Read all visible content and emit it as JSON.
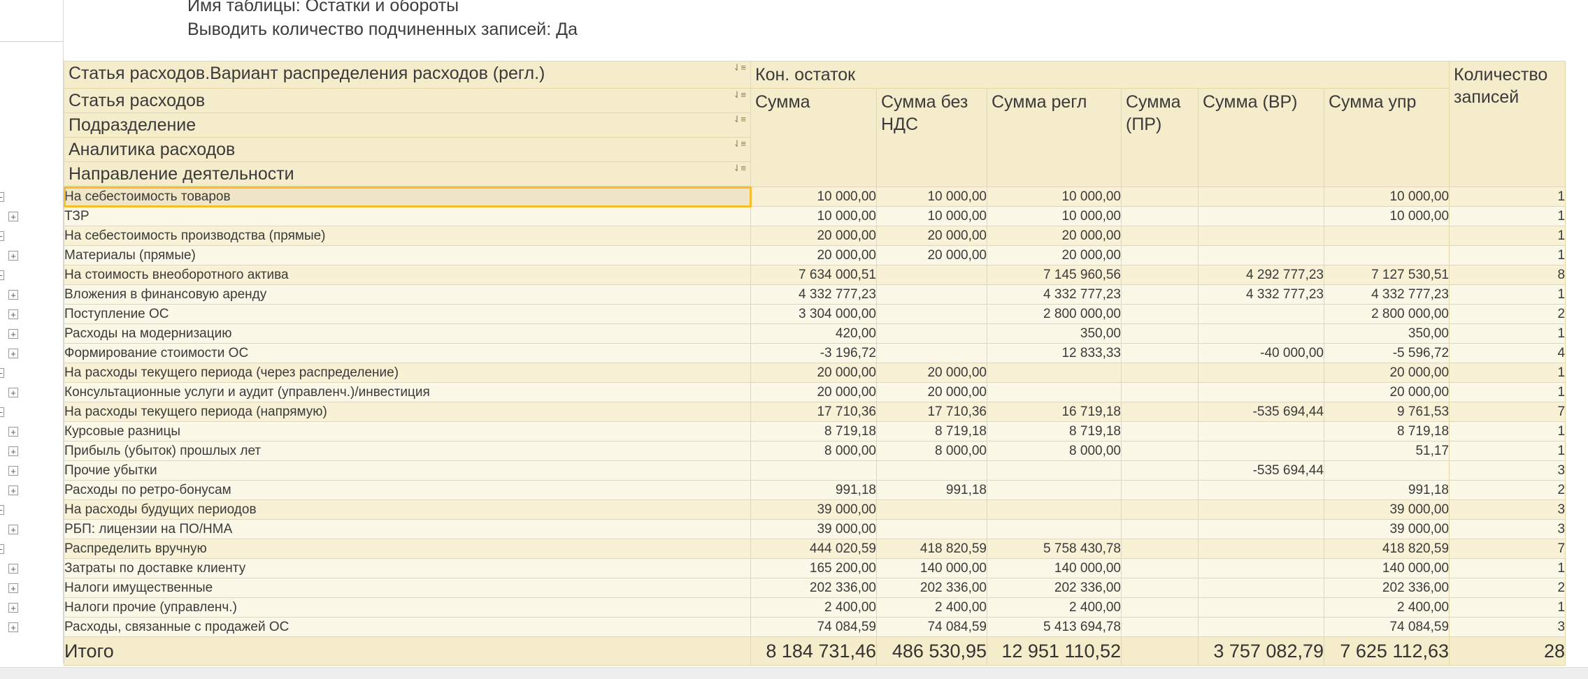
{
  "params": {
    "table_name": "Имя таблицы: Остатки и обороты",
    "show_count": "Выводить количество подчиненных записей: Да"
  },
  "header": {
    "grouping": [
      "Статья расходов.Вариант распределения расходов (регл.)",
      "Статья расходов",
      "Подразделение",
      "Аналитика расходов",
      "Направление деятельности"
    ],
    "sort_icon": "sort-icon",
    "group_title": "Кон. остаток",
    "columns": [
      "Сумма",
      "Сумма без НДС",
      "Сумма регл",
      "Сумма (ПР)",
      "Сумма (ВР)",
      "Сумма упр"
    ],
    "count_col": "Количество записей"
  },
  "rows": [
    {
      "label": "На себестоимость товаров",
      "level": 0,
      "selected": true,
      "v": [
        "10 000,00",
        "10 000,00",
        "10 000,00",
        "",
        "",
        "10 000,00"
      ],
      "count": "1"
    },
    {
      "label": "ТЗР",
      "level": 1,
      "v": [
        "10 000,00",
        "10 000,00",
        "10 000,00",
        "",
        "",
        "10 000,00"
      ],
      "count": "1"
    },
    {
      "label": "На себестоимость производства (прямые)",
      "level": 0,
      "v": [
        "20 000,00",
        "20 000,00",
        "20 000,00",
        "",
        "",
        ""
      ],
      "count": "1"
    },
    {
      "label": "Материалы (прямые)",
      "level": 1,
      "v": [
        "20 000,00",
        "20 000,00",
        "20 000,00",
        "",
        "",
        ""
      ],
      "count": "1"
    },
    {
      "label": "На стоимость внеоборотного актива",
      "level": 0,
      "v": [
        "7 634 000,51",
        "",
        "7 145 960,56",
        "",
        "4 292 777,23",
        "7 127 530,51"
      ],
      "count": "8"
    },
    {
      "label": "Вложения в финансовую аренду",
      "level": 1,
      "v": [
        "4 332 777,23",
        "",
        "4 332 777,23",
        "",
        "4 332 777,23",
        "4 332 777,23"
      ],
      "count": "1"
    },
    {
      "label": "Поступление ОС",
      "level": 1,
      "v": [
        "3 304 000,00",
        "",
        "2 800 000,00",
        "",
        "",
        "2 800 000,00"
      ],
      "count": "2"
    },
    {
      "label": "Расходы на модернизацию",
      "level": 1,
      "v": [
        "420,00",
        "",
        "350,00",
        "",
        "",
        "350,00"
      ],
      "count": "1"
    },
    {
      "label": "Формирование стоимости ОС",
      "level": 1,
      "v": [
        "-3 196,72",
        "",
        "12 833,33",
        "",
        "-40 000,00",
        "-5 596,72"
      ],
      "count": "4"
    },
    {
      "label": "На расходы текущего периода (через распределение)",
      "level": 0,
      "v": [
        "20 000,00",
        "20 000,00",
        "",
        "",
        "",
        "20 000,00"
      ],
      "count": "1"
    },
    {
      "label": "Консультационные услуги и аудит (управленч.)/инвестиция",
      "level": 1,
      "v": [
        "20 000,00",
        "20 000,00",
        "",
        "",
        "",
        "20 000,00"
      ],
      "count": "1"
    },
    {
      "label": "На расходы текущего периода (напрямую)",
      "level": 0,
      "v": [
        "17 710,36",
        "17 710,36",
        "16 719,18",
        "",
        "-535 694,44",
        "9 761,53"
      ],
      "count": "7"
    },
    {
      "label": "Курсовые разницы",
      "level": 1,
      "v": [
        "8 719,18",
        "8 719,18",
        "8 719,18",
        "",
        "",
        "8 719,18"
      ],
      "count": "1"
    },
    {
      "label": "Прибыль (убыток) прошлых лет",
      "level": 1,
      "v": [
        "8 000,00",
        "8 000,00",
        "8 000,00",
        "",
        "",
        "51,17"
      ],
      "count": "1"
    },
    {
      "label": "Прочие убытки",
      "level": 1,
      "v": [
        "",
        "",
        "",
        "",
        "-535 694,44",
        ""
      ],
      "count": "3"
    },
    {
      "label": "Расходы по ретро-бонусам",
      "level": 1,
      "v": [
        "991,18",
        "991,18",
        "",
        "",
        "",
        "991,18"
      ],
      "count": "2"
    },
    {
      "label": "На расходы будущих периодов",
      "level": 0,
      "v": [
        "39 000,00",
        "",
        "",
        "",
        "",
        "39 000,00"
      ],
      "count": "3"
    },
    {
      "label": "РБП: лицензии на ПО/НМА",
      "level": 1,
      "v": [
        "39 000,00",
        "",
        "",
        "",
        "",
        "39 000,00"
      ],
      "count": "3"
    },
    {
      "label": "Распределить вручную",
      "level": 0,
      "v": [
        "444 020,59",
        "418 820,59",
        "5 758 430,78",
        "",
        "",
        "418 820,59"
      ],
      "count": "7"
    },
    {
      "label": "Затраты по доставке клиенту",
      "level": 1,
      "v": [
        "165 200,00",
        "140 000,00",
        "140 000,00",
        "",
        "",
        "140 000,00"
      ],
      "count": "1"
    },
    {
      "label": "Налоги имущественные",
      "level": 1,
      "v": [
        "202 336,00",
        "202 336,00",
        "202 336,00",
        "",
        "",
        "202 336,00"
      ],
      "count": "2"
    },
    {
      "label": "Налоги прочие (управленч.)",
      "level": 1,
      "v": [
        "2 400,00",
        "2 400,00",
        "2 400,00",
        "",
        "",
        "2 400,00"
      ],
      "count": "1"
    },
    {
      "label": "Расходы, связанные с продажей ОС",
      "level": 1,
      "v": [
        "74 084,59",
        "74 084,59",
        "5 413 694,78",
        "",
        "",
        "74 084,59"
      ],
      "count": "3"
    }
  ],
  "total": {
    "label": "Итого",
    "v": [
      "8 184 731,46",
      "486 530,95",
      "12 951 110,52",
      "",
      "3 757 082,79",
      "7 625 112,63"
    ],
    "count": "28"
  },
  "icons": {
    "expand": "⊞",
    "collapse": "⊟",
    "sort": "⇃≡"
  }
}
